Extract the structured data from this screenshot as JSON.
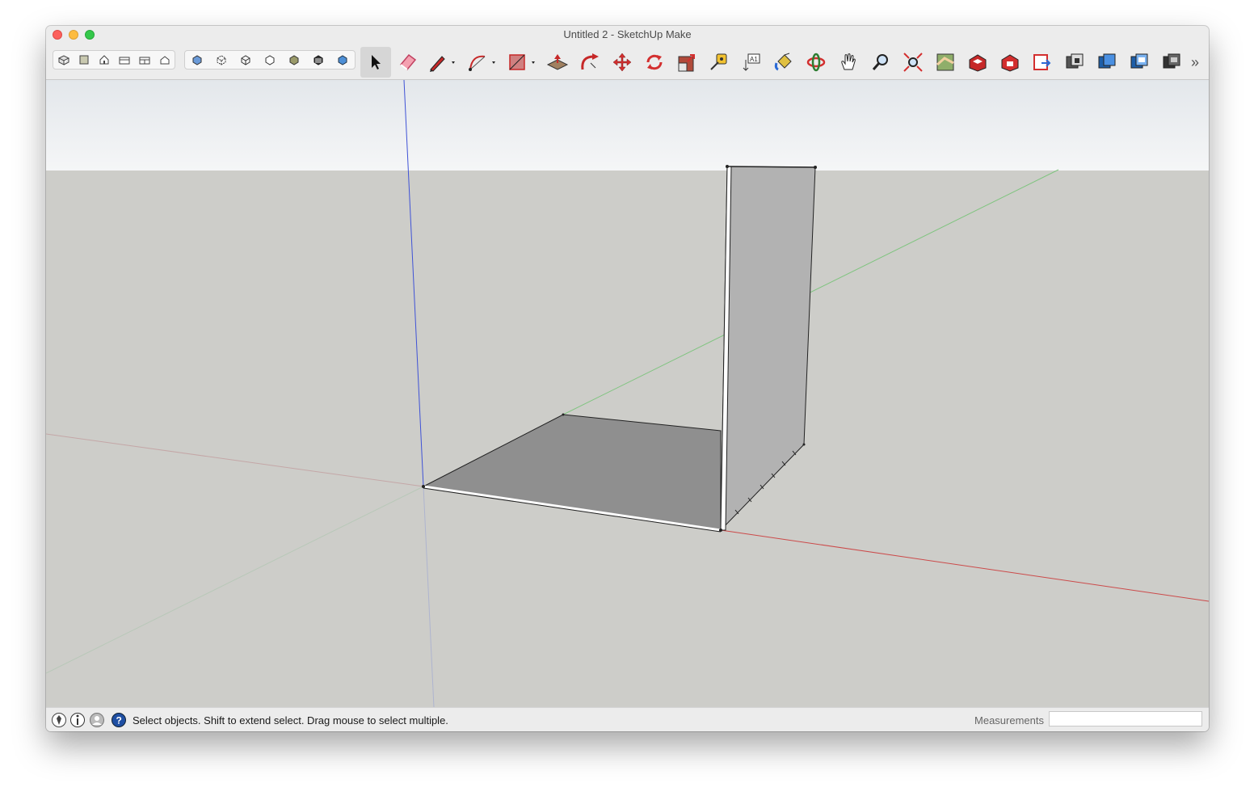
{
  "window": {
    "title": "Untitled 2 - SketchUp Make"
  },
  "toolbar": {
    "view_buttons": [
      "iso-view",
      "top-view",
      "front-view",
      "right-view",
      "back-view",
      "left-view"
    ],
    "style_buttons": [
      "xray-style",
      "back-edges-style",
      "wireframe-style",
      "hidden-line-style",
      "shaded-style",
      "shaded-textures-style",
      "monochrome-style"
    ],
    "tools": [
      "select",
      "eraser",
      "line",
      "arc",
      "rectangle",
      "push-pull",
      "follow-me",
      "move",
      "rotate",
      "scale",
      "tape-measure",
      "text",
      "paint-bucket",
      "orbit",
      "pan",
      "zoom",
      "zoom-extents",
      "position-camera",
      "3d-warehouse",
      "extension-warehouse",
      "send-to-layout",
      "components",
      "materials",
      "layers",
      "styles"
    ],
    "overflow_glyph": "»"
  },
  "statusbar": {
    "message": "Select objects. Shift to extend select. Drag mouse to select multiple.",
    "measurements_label": "Measurements",
    "measurements_value": ""
  },
  "colors": {
    "sky": "#eef1f4",
    "ground": "#cdcdc9",
    "blue_axis": "#3f52d6",
    "green_axis": "#7fc47f",
    "red_axis": "#cc4a4a",
    "floor_face": "#8f8f8f",
    "wall_face": "#b2b2b2"
  }
}
